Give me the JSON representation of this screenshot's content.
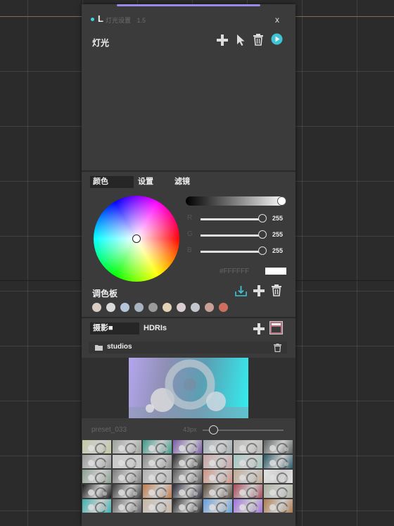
{
  "window": {
    "title_letter": "L",
    "title_text": "灯光设置",
    "version": "1.5",
    "close_label": "x"
  },
  "lights": {
    "header": "灯光"
  },
  "color_tabs": [
    "颜色",
    "设置",
    "滤镜"
  ],
  "color": {
    "r_label": "R",
    "g_label": "G",
    "b_label": "B",
    "r_value": "255",
    "g_value": "255",
    "b_value": "255",
    "hex": "#FFFFFF",
    "swatch_color": "#FFFFFF"
  },
  "palette": {
    "label": "调色板",
    "swatches": [
      "#dccdc2",
      "#dadadc",
      "#b4c6d8",
      "#a9b4c3",
      "#9b9b9b",
      "#e4d2b4",
      "#dccdd2",
      "#c3c6cd",
      "#c8a096",
      "#cd6e5f"
    ]
  },
  "hdri": {
    "tabs": [
      "摄影■",
      "HDRIs"
    ],
    "folder": "studios",
    "preset_name": "preset_033",
    "zoom_label": "43px",
    "zoom_level": 0.08
  },
  "thumbnails": [
    [
      "#c3c8a0",
      "#9aa09a",
      "#3a9a8a",
      "#7a5aaa",
      "#a0aab0",
      "#b4b4b0",
      "#5a6060"
    ],
    [
      "#9a9a9a",
      "#c8c8c8",
      "#8a8a8a",
      "#2a2a2a",
      "#c8a0a0",
      "#a0c8c0",
      "#2a5a6a"
    ],
    [
      "#8aa090",
      "#7a7a7a",
      "#b0b0b0",
      "#5a5a5a",
      "#d09080",
      "#c0a890",
      "#e0e0e0"
    ],
    [
      "#1a1a1a",
      "#3a3a3a",
      "#c07a4a",
      "#2a2a3a",
      "#5a4a3a",
      "#aa4a5a",
      "#aab0a0"
    ],
    [
      "#3ab0b0",
      "#606060",
      "#c8b4a0",
      "#2a2a2a",
      "#60a0e0",
      "#a070e0",
      "#b07a4a"
    ]
  ]
}
